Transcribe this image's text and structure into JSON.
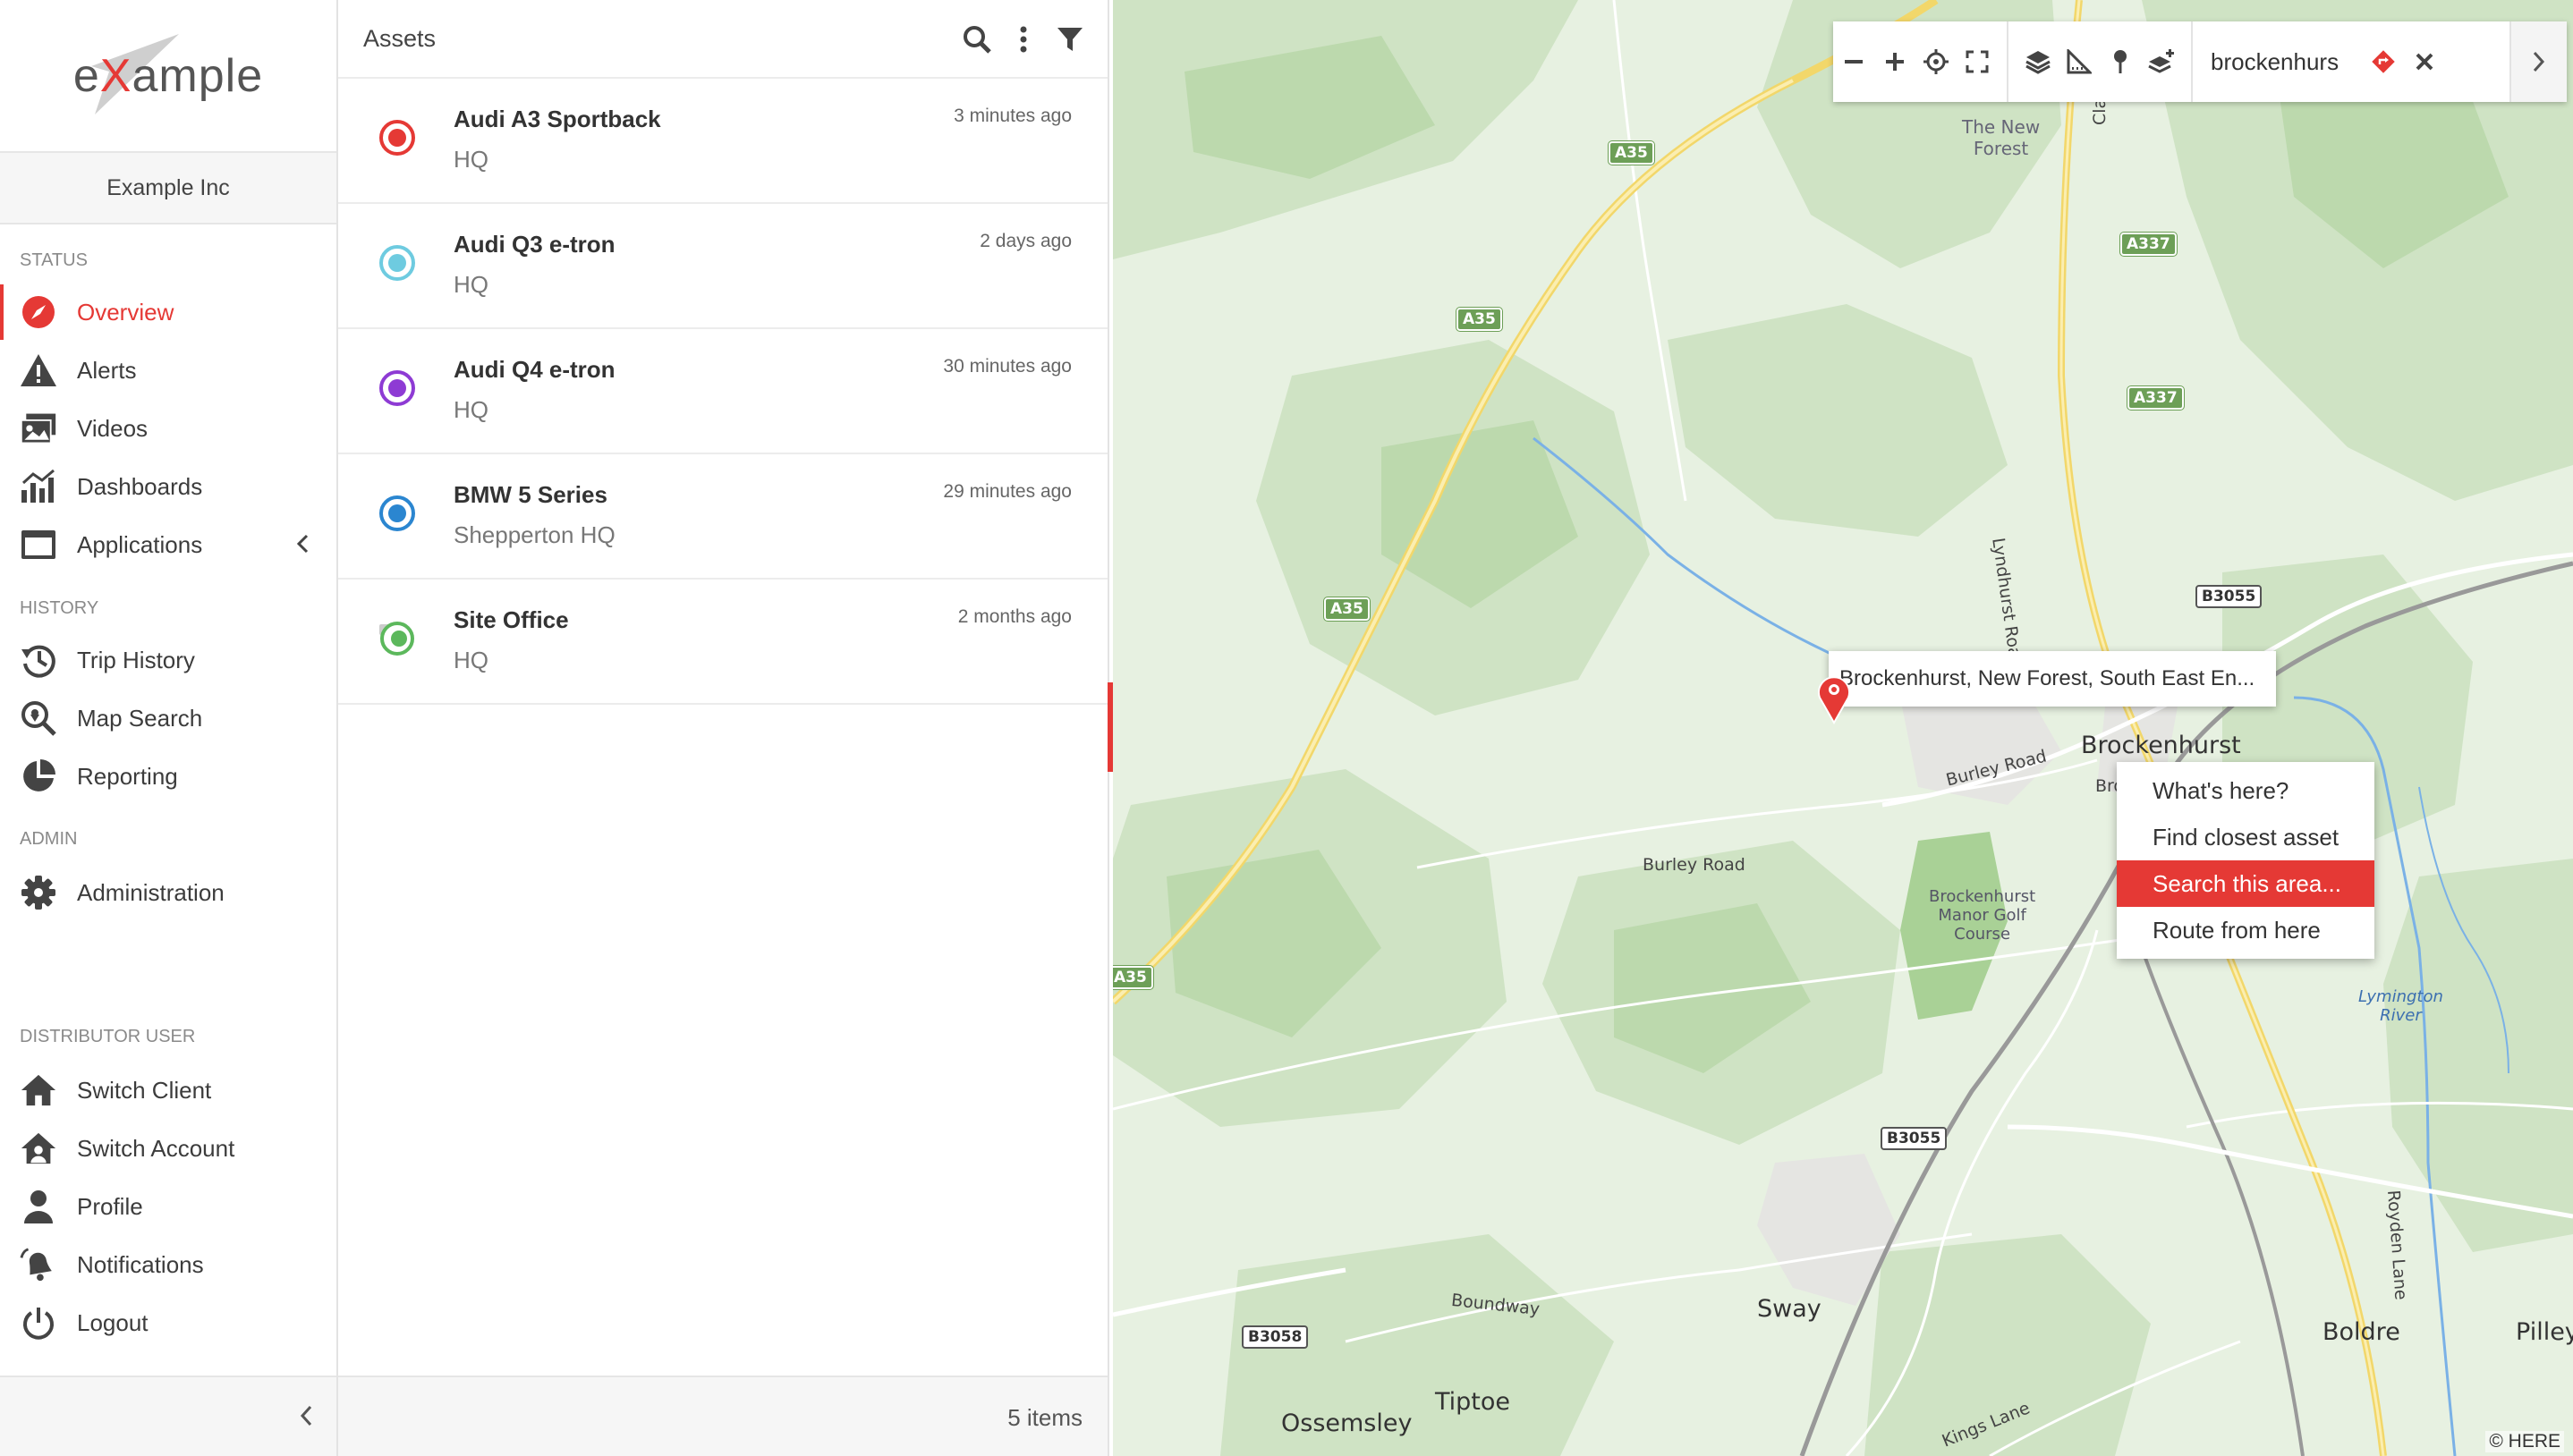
{
  "brand": {
    "logo_prefix": "e",
    "logo_x": "X",
    "logo_suffix": "ample",
    "accent": "#e53935"
  },
  "sidebar": {
    "company": "Example Inc",
    "sections": {
      "status": "STATUS",
      "history": "HISTORY",
      "admin": "ADMIN",
      "distributor": "DISTRIBUTOR USER"
    },
    "items": [
      {
        "label": "Overview",
        "icon": "compass-icon",
        "active": true
      },
      {
        "label": "Alerts",
        "icon": "warning-icon"
      },
      {
        "label": "Videos",
        "icon": "videos-icon"
      },
      {
        "label": "Dashboards",
        "icon": "chart-icon"
      },
      {
        "label": "Applications",
        "icon": "window-icon"
      },
      {
        "label": "Trip History",
        "icon": "history-icon"
      },
      {
        "label": "Map Search",
        "icon": "map-search-icon"
      },
      {
        "label": "Reporting",
        "icon": "pie-chart-icon"
      },
      {
        "label": "Administration",
        "icon": "gear-icon"
      },
      {
        "label": "Switch Client",
        "icon": "home-icon"
      },
      {
        "label": "Switch Account",
        "icon": "home-user-icon"
      },
      {
        "label": "Profile",
        "icon": "person-icon"
      },
      {
        "label": "Notifications",
        "icon": "bell-icon"
      },
      {
        "label": "Logout",
        "icon": "power-icon"
      }
    ]
  },
  "assets": {
    "title": "Assets",
    "count_label": "5 items",
    "rows": [
      {
        "name": "Audi A3 Sportback",
        "location": "HQ",
        "time": "3 minutes ago",
        "status_color": "#e53935"
      },
      {
        "name": "Audi Q3 e-tron",
        "location": "HQ",
        "time": "2 days ago",
        "status_color": "#6ecbe0"
      },
      {
        "name": "Audi Q4 e-tron",
        "location": "HQ",
        "time": "30 minutes ago",
        "status_color": "#8e3bd4"
      },
      {
        "name": "BMW 5 Series",
        "location": "Shepperton HQ",
        "time": "29 minutes ago",
        "status_color": "#2b86d0"
      },
      {
        "name": "Site Office",
        "location": "HQ",
        "time": "2 months ago",
        "status_color": "#5cb85c"
      }
    ]
  },
  "map": {
    "search_value": "brockenhurs",
    "popup": "Brockenhurst, New Forest, South East En...",
    "context_menu": [
      "What's here?",
      "Find closest asset",
      "Search this area...",
      "Route from here"
    ],
    "highlighted_menu_item": "Search this area...",
    "attribution": "© HERE",
    "places": {
      "new_forest": "The New\nForest",
      "brockenhurst": "Brockenhurst",
      "sway": "Sway",
      "boldre": "Boldre",
      "pilley": "Pilley",
      "tiptoe": "Tiptoe",
      "ossemsley": "Ossemsley",
      "golf": "Brockenhurst\nManor Golf\nCourse",
      "lymington_river": "Lymington\nRiver",
      "burley_road_1": "Burley Road",
      "burley_road_2": "Burley Road",
      "boundway": "Boundway",
      "kings_lane": "Kings Lane",
      "lyndhurst_road": "Lyndhurst Road",
      "clay_hill": "Clay H",
      "royden_lane": "Royden Lane",
      "bro": "Bro"
    },
    "roads": {
      "a35_1": "A35",
      "a35_2": "A35",
      "a35_3": "A35",
      "a35_4": "A35",
      "a337_1": "A337",
      "a337_2": "A337",
      "b3055_1": "B3055",
      "b3055_2": "B3055",
      "b3058": "B3058"
    }
  }
}
